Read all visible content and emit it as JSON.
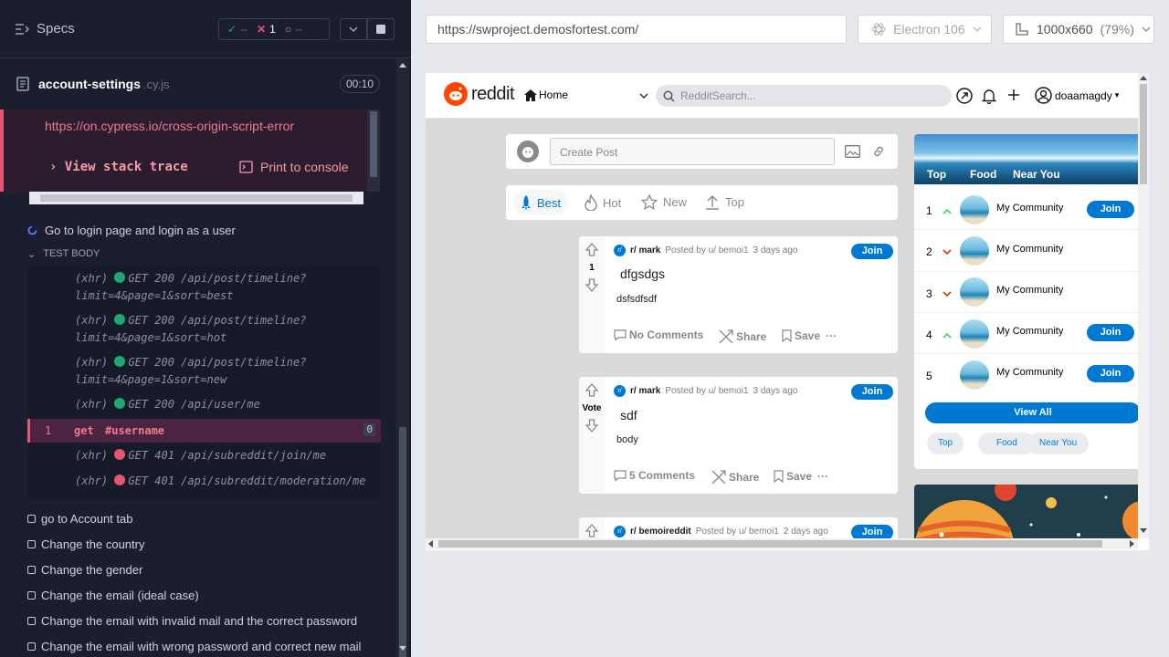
{
  "left": {
    "specs_label": "Specs",
    "stats": {
      "passed": "--",
      "failed": "1",
      "pending": "--"
    },
    "file": {
      "name": "account-settings",
      "ext": ".cy.js",
      "timer": "00:10"
    },
    "error": {
      "url": "https://on.cypress.io/cross-origin-script-error",
      "view_stack": "View stack trace",
      "print": "Print to console"
    },
    "hook_title": "Go to login page and login as a user",
    "body_header": "TEST BODY",
    "commands": [
      {
        "l1": "(xhr)  ",
        "method": "GET 200 /api/post/timeline?",
        "l2": "limit=4&page=1&sort=best",
        "status": "ok"
      },
      {
        "l1": "(xhr)  ",
        "method": "GET 200 /api/post/timeline?",
        "l2": "limit=4&page=1&sort=hot",
        "status": "ok"
      },
      {
        "l1": "(xhr)  ",
        "method": "GET 200 /api/post/timeline?",
        "l2": "limit=4&page=1&sort=new",
        "status": "ok"
      },
      {
        "l1": "(xhr)  ",
        "method": "GET 200 /api/user/me",
        "l2": "",
        "status": "ok"
      }
    ],
    "get_cmd": {
      "num": "1",
      "name": "get",
      "selector": "#username",
      "count": "0"
    },
    "commands_after": [
      {
        "l1": "(xhr)  ",
        "method": "GET 401 /api/subreddit/join/me",
        "status": "fail"
      },
      {
        "l1": "(xhr)  ",
        "method": "GET 401 /api/subreddit/moderation/me",
        "status": "fail"
      }
    ],
    "todos": [
      "go to Account tab",
      "Change the country",
      "Change the gender",
      "Change the email (ideal case)",
      "Change the email with invalid mail and the correct password",
      "Change the email with wrong password and correct new mail"
    ],
    "colors": {
      "ok": "#1fa971",
      "fail": "#e45770"
    }
  },
  "right": {
    "url": "https://swproject.demosfortest.com/",
    "browser": "Electron 106",
    "viewport": "1000x660",
    "zoom": "(79%)"
  },
  "reddit": {
    "brand": "reddit",
    "home": "Home",
    "search_placeholder": "RedditSearch...",
    "username": "doaamagdy",
    "create_post": "Create Post",
    "sorts": [
      "Best",
      "Hot",
      "New",
      "Top"
    ],
    "posts": [
      {
        "sub": "r/ mark",
        "by": "Posted by u/ bemoi1",
        "time": "3 days ago",
        "votes": "1",
        "title": "dfgsdgs",
        "body": "dsfsdfsdf",
        "comments": "No Comments",
        "share": "Share",
        "save": "Save",
        "join": "Join"
      },
      {
        "sub": "r/ mark",
        "by": "Posted by u/ bemoi1",
        "time": "3 days ago",
        "votes": "Vote",
        "title": "sdf",
        "body": "body",
        "comments": "5 Comments",
        "share": "Share",
        "save": "Save",
        "join": "Join"
      },
      {
        "sub": "r/ bemoireddit",
        "by": "Posted by u/ bemoi1",
        "time": "2 days ago",
        "join": "Join"
      }
    ],
    "banner_tabs": [
      "Top",
      "Food",
      "Near You"
    ],
    "communities": [
      {
        "rank": "1",
        "name": "My Community",
        "trend": "up",
        "join": "Join"
      },
      {
        "rank": "2",
        "name": "My Community",
        "trend": "down",
        "join": ""
      },
      {
        "rank": "3",
        "name": "My Community",
        "trend": "down",
        "join": ""
      },
      {
        "rank": "4",
        "name": "My Community",
        "trend": "up",
        "join": "Join"
      },
      {
        "rank": "5",
        "name": "My Community",
        "trend": "none",
        "join": "Join"
      }
    ],
    "view_all": "View All",
    "chips": [
      "Top",
      "Food",
      "Near You"
    ]
  }
}
